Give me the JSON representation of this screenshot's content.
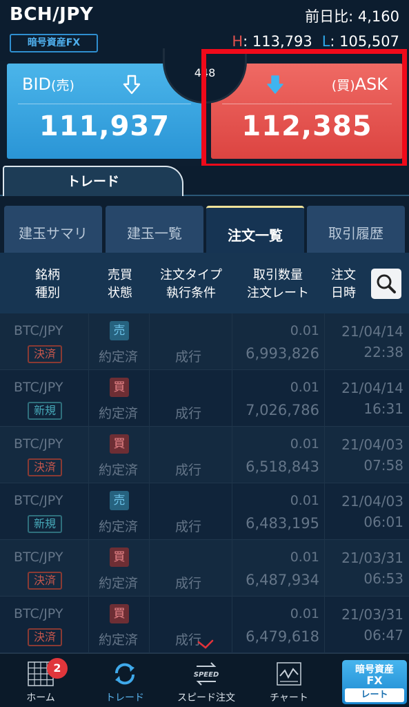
{
  "header": {
    "pair": "BCH/JPY",
    "badge": "暗号資産FX",
    "prev_day": "前日比: 4,160",
    "high_label": "H",
    "high_value": ": 113,793",
    "low_label": "L",
    "low_value": ": 105,507"
  },
  "quote": {
    "bid_label": "BID",
    "bid_sub": "(売)",
    "bid_price": "111,937",
    "ask_sub": "(買)",
    "ask_label": "ASK",
    "ask_price": "112,385",
    "spread": "448"
  },
  "trade_tab": "トレード",
  "subtabs": [
    "建玉サマリ",
    "建玉一覧",
    "注文一覧",
    "取引履歴"
  ],
  "active_subtab": "注文一覧",
  "columns": {
    "c1a": "銘柄",
    "c1b": "種別",
    "c2a": "売買",
    "c2b": "状態",
    "c3a": "注文タイプ",
    "c3b": "執行条件",
    "c4a": "取引数量",
    "c4b": "注文レート",
    "c5a": "注文",
    "c5b": "日時"
  },
  "orders": [
    {
      "symbol": "BTC/JPY",
      "kind": "決済",
      "side": "売",
      "status": "約定済",
      "type": "成行",
      "qty": "0.01",
      "rate": "6,993,826",
      "date": "21/04/14",
      "time": "22:38"
    },
    {
      "symbol": "BTC/JPY",
      "kind": "新規",
      "side": "買",
      "status": "約定済",
      "type": "成行",
      "qty": "0.01",
      "rate": "7,026,786",
      "date": "21/04/14",
      "time": "16:31"
    },
    {
      "symbol": "BTC/JPY",
      "kind": "決済",
      "side": "買",
      "status": "約定済",
      "type": "成行",
      "qty": "0.01",
      "rate": "6,518,843",
      "date": "21/04/03",
      "time": "07:58"
    },
    {
      "symbol": "BTC/JPY",
      "kind": "新規",
      "side": "売",
      "status": "約定済",
      "type": "成行",
      "qty": "0.01",
      "rate": "6,483,195",
      "date": "21/04/03",
      "time": "06:01"
    },
    {
      "symbol": "BTC/JPY",
      "kind": "決済",
      "side": "買",
      "status": "約定済",
      "type": "成行",
      "qty": "0.01",
      "rate": "6,487,934",
      "date": "21/03/31",
      "time": "06:53"
    },
    {
      "symbol": "BTC/JPY",
      "kind": "決済",
      "side": "買",
      "status": "約定済",
      "type": "成行",
      "qty": "0.01",
      "rate": "6,479,618",
      "date": "21/03/31",
      "time": "06:47"
    }
  ],
  "nav": {
    "home": "ホーム",
    "home_badge": "2",
    "trade": "トレード",
    "speed": "スピード注文",
    "speed_icon_text": "SPEED",
    "chart": "チャート",
    "fx_line1": "暗号資産",
    "fx_line2": "FX",
    "fx_line3": "レート"
  },
  "colors": {
    "bid": "#2a95d6",
    "ask": "#dc4441",
    "highlight": "#f00a1a",
    "background": "#0d1e30"
  }
}
